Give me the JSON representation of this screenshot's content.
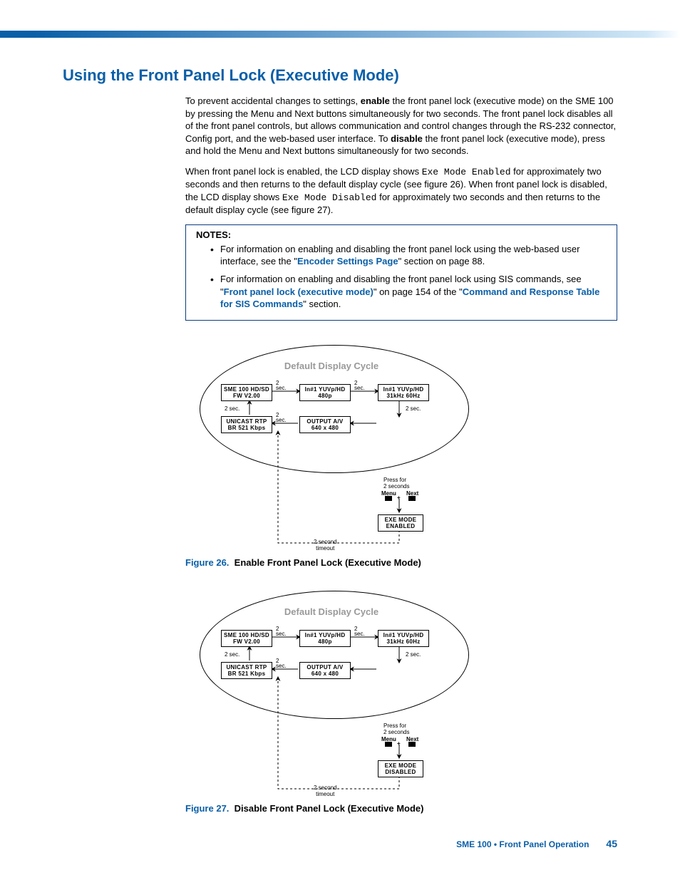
{
  "heading": "Using the Front Panel Lock (Executive Mode)",
  "p1a": "To prevent accidental changes to settings, ",
  "p1b": "enable",
  "p1c": " the front panel lock (executive mode) on the SME 100 by pressing the Menu and Next buttons simultaneously for two seconds. The front panel lock disables all of the front panel controls, but allows communication and control changes through the RS-232 connector, Config port, and the web-based user interface. To ",
  "p1d": "disable",
  "p1e": " the front panel lock (executive mode), press and hold the Menu and Next buttons simultaneously for two seconds.",
  "p2a": "When front panel lock is enabled, the LCD display shows ",
  "p2b": "Exe Mode Enabled",
  "p2c": " for approximately two seconds and then returns to the default display cycle (see figure 26). When front panel lock is disabled, the LCD display shows ",
  "p2d": "Exe Mode Disabled",
  "p2e": " for approximately two seconds and then returns to the default display cycle (see figure 27).",
  "notes": {
    "title": "NOTES:",
    "n1a": "For information on enabling and disabling the front panel lock using the web-based user interface, see the \"",
    "n1b": "Encoder Settings Page",
    "n1c": "\" section on page 88.",
    "n2a": "For information on enabling and disabling the front panel lock using SIS commands, see \"",
    "n2b": "Front panel lock (executive mode)",
    "n2c": "\" on page 154 of the \"",
    "n2d": "Command and Response Table for SIS Commands",
    "n2e": "\" section."
  },
  "diag": {
    "title": "Default Display Cycle",
    "b1l1": "SME 100 HD/SD",
    "b1l2": "FW  V2.00",
    "b2l1": "In#1  YUVp/HD",
    "b2l2": "480p",
    "b3l1": "In#1  YUVp/HD",
    "b3l2": "31kHz  60Hz",
    "b4l1": "UNICAST  RTP",
    "b4l2": "BR  521 Kbps",
    "b5l1": "OUTPUT  A/V",
    "b5l2": "640 x 480",
    "twosec": "2 sec.",
    "twoseclong": "2 sec.",
    "press": "Press for\n2 seconds",
    "menu": "Menu",
    "next": "Next",
    "plus": "+",
    "exe26l1": "EXE  MODE",
    "exe26l2": "ENABLED",
    "exe27l1": "EXE  MODE",
    "exe27l2": "DISABLED",
    "timeout": "2 second\ntimeout"
  },
  "fig26num": "Figure 26.",
  "fig26txt": "Enable Front Panel Lock (Executive Mode)",
  "fig27num": "Figure 27.",
  "fig27txt": "Disable Front Panel Lock (Executive Mode)",
  "footer": {
    "txt": "SME 100 • Front Panel Operation",
    "page": "45"
  }
}
